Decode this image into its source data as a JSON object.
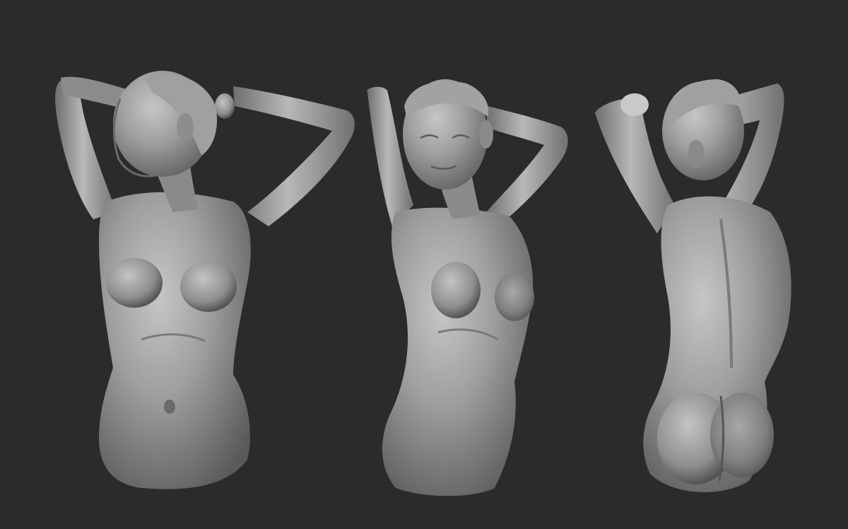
{
  "scene": {
    "background_color": "#2b2b2b",
    "material_color": "#9a9a9a",
    "highlight_color": "#c8c8c8",
    "shadow_color": "#4a4a4a",
    "views": [
      {
        "view": "front-three-quarter"
      },
      {
        "view": "front-turned"
      },
      {
        "view": "back-three-quarter"
      }
    ]
  }
}
